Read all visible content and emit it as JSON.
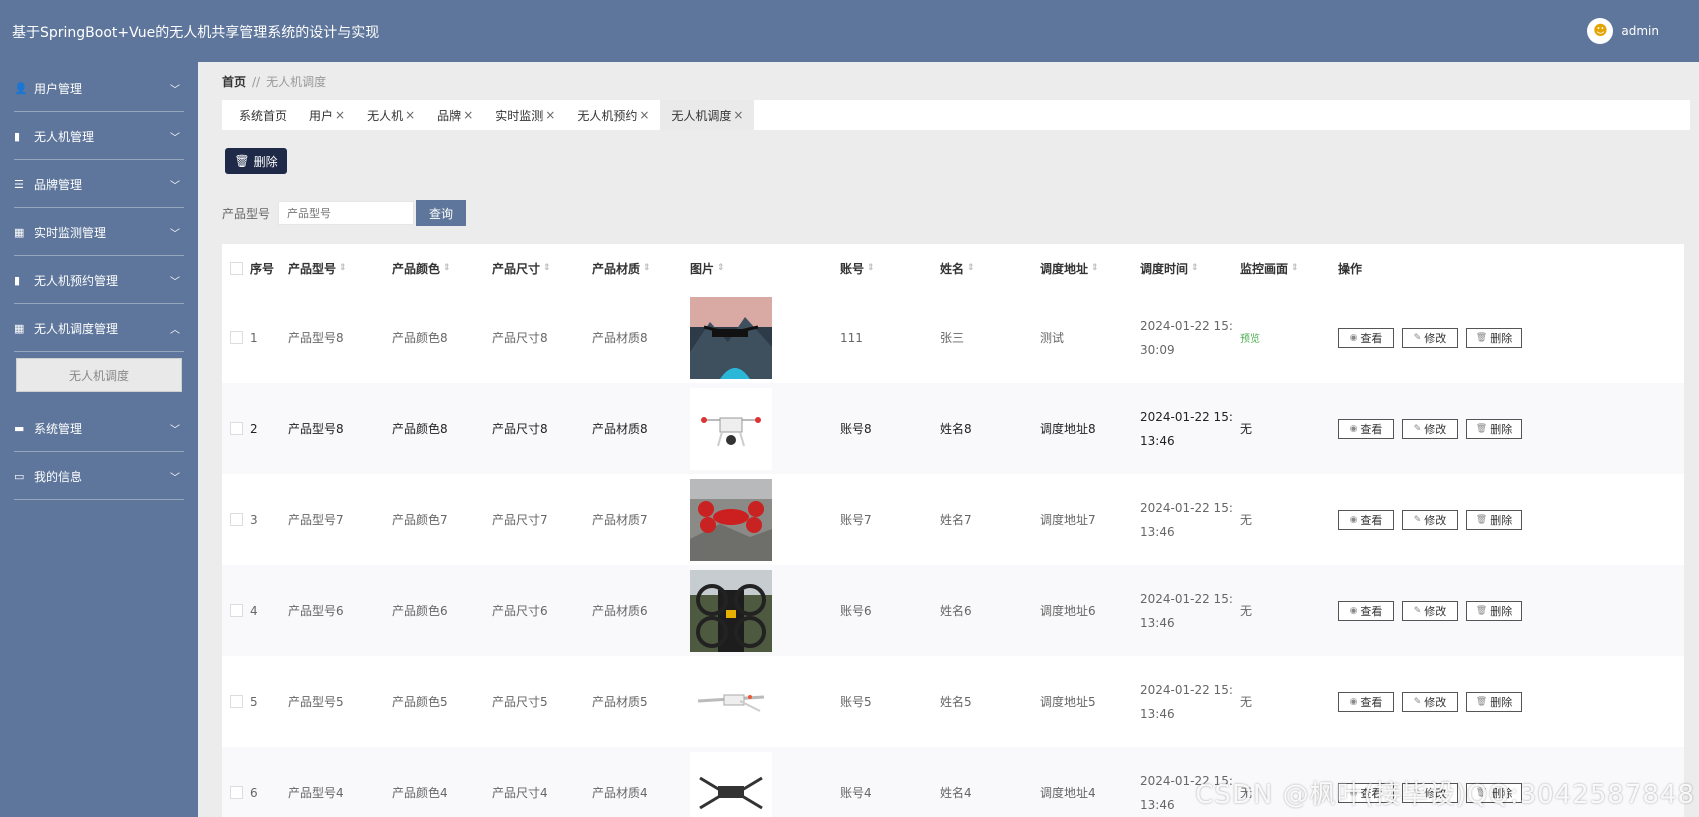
{
  "header": {
    "title": "基于SpringBoot+Vue的无人机共享管理系统的设计与实现",
    "username": "admin"
  },
  "sidebar": {
    "items": [
      {
        "label": "用户管理",
        "icon": "user-icon",
        "glyph": "👤"
      },
      {
        "label": "无人机管理",
        "icon": "clipboard-icon",
        "glyph": "▮"
      },
      {
        "label": "品牌管理",
        "icon": "list-icon",
        "glyph": "☰"
      },
      {
        "label": "实时监测管理",
        "icon": "grid-icon",
        "glyph": "▦"
      },
      {
        "label": "无人机预约管理",
        "icon": "clipboard-icon",
        "glyph": "▮"
      },
      {
        "label": "无人机调度管理",
        "icon": "grid-icon",
        "glyph": "▦",
        "expanded": true
      },
      {
        "label": "系统管理",
        "icon": "monitor-icon",
        "glyph": "▬"
      },
      {
        "label": "我的信息",
        "icon": "card-icon",
        "glyph": "▭"
      }
    ],
    "sub_item": "无人机调度"
  },
  "breadcrumb": {
    "home": "首页",
    "sep": "//",
    "current": "无人机调度"
  },
  "tabs": [
    {
      "label": "系统首页",
      "closable": false
    },
    {
      "label": "用户",
      "closable": true
    },
    {
      "label": "无人机",
      "closable": true
    },
    {
      "label": "品牌",
      "closable": true
    },
    {
      "label": "实时监测",
      "closable": true
    },
    {
      "label": "无人机预约",
      "closable": true
    },
    {
      "label": "无人机调度",
      "closable": true,
      "active": true
    }
  ],
  "toolbar": {
    "delete_label": "删除"
  },
  "search": {
    "label": "产品型号",
    "placeholder": "产品型号",
    "button": "查询"
  },
  "table": {
    "columns": [
      "序号",
      "产品型号",
      "产品颜色",
      "产品尺寸",
      "产品材质",
      "图片",
      "账号",
      "姓名",
      "调度地址",
      "调度时间",
      "监控画面",
      "操作"
    ],
    "actions": {
      "view": "查看",
      "edit": "修改",
      "delete": "删除"
    },
    "rows": [
      {
        "idx": "1",
        "model": "产品型号8",
        "color": "产品颜色8",
        "size": "产品尺寸8",
        "material": "产品材质8",
        "image": "drone-over-mountain",
        "account": "111",
        "name": "张三",
        "address": "测试",
        "time": "2024-01-22 15:30:09",
        "monitor": "预览",
        "monitor_link": true
      },
      {
        "idx": "2",
        "model": "产品型号8",
        "color": "产品颜色8",
        "size": "产品尺寸8",
        "material": "产品材质8",
        "image": "white-quadcopter",
        "account": "账号8",
        "name": "姓名8",
        "address": "调度地址8",
        "time": "2024-01-22 15:13:46",
        "monitor": "无",
        "monitor_link": false
      },
      {
        "idx": "3",
        "model": "产品型号7",
        "color": "产品颜色7",
        "size": "产品尺寸7",
        "material": "产品材质7",
        "image": "red-drone-on-rocks",
        "account": "账号7",
        "name": "姓名7",
        "address": "调度地址7",
        "time": "2024-01-22 15:13:46",
        "monitor": "无",
        "monitor_link": false
      },
      {
        "idx": "4",
        "model": "产品型号6",
        "color": "产品颜色6",
        "size": "产品尺寸6",
        "material": "产品材质6",
        "image": "person-with-drone",
        "account": "账号6",
        "name": "姓名6",
        "address": "调度地址6",
        "time": "2024-01-22 15:13:46",
        "monitor": "无",
        "monitor_link": false
      },
      {
        "idx": "5",
        "model": "产品型号5",
        "color": "产品颜色5",
        "size": "产品尺寸5",
        "material": "产品材质5",
        "image": "fixed-wing-drone",
        "account": "账号5",
        "name": "姓名5",
        "address": "调度地址5",
        "time": "2024-01-22 15:13:46",
        "monitor": "无",
        "monitor_link": false
      },
      {
        "idx": "6",
        "model": "产品型号4",
        "color": "产品颜色4",
        "size": "产品尺寸4",
        "material": "产品材质4",
        "image": "folding-drone",
        "account": "账号4",
        "name": "姓名4",
        "address": "调度地址4",
        "time": "2024-01-22 15:13:46",
        "monitor": "无",
        "monitor_link": false
      }
    ]
  },
  "watermark": "CSDN @枫叶(接毕设)QQ:3042587848"
}
